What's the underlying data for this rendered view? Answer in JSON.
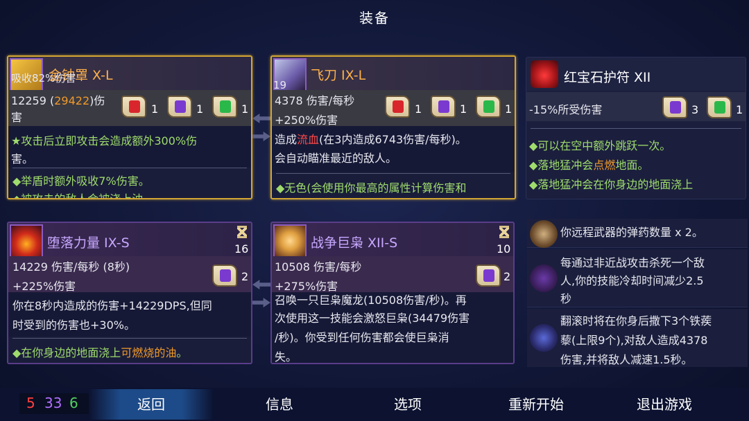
{
  "page": {
    "title": "装备"
  },
  "cards": {
    "weapon1": {
      "name": "金钟罩 X-L",
      "icon_count": "",
      "overlay": "吸收82%伤害",
      "stat1": "12259 (",
      "stat1_hi": "29422",
      "stat1_end": ")伤",
      "stat2": "害",
      "scrolls": [
        {
          "color": "red",
          "count": "1"
        },
        {
          "color": "purple",
          "count": "1"
        },
        {
          "color": "green",
          "count": "1"
        }
      ],
      "desc_line1_prefix": "★攻击后立即攻击会造成额外300%伤",
      "desc_line2": "害。",
      "mod1": "◆举盾时额外吸收7%伤害。",
      "mod2": "◆被攻击的敌人会被浇上油"
    },
    "weapon2": {
      "name": "飞刀 IX-L",
      "icon_count": "19",
      "stat1": "4378 伤害/每秒",
      "stat2": "+250%伤害",
      "scrolls": [
        {
          "color": "red",
          "count": "1"
        },
        {
          "color": "purple",
          "count": "1"
        },
        {
          "color": "green",
          "count": "1"
        }
      ],
      "desc_a": "造成",
      "desc_b": "流血",
      "desc_c": "(在3内造成6743伤害/每秒)。",
      "desc_line2": "会自动瞄准最近的敌人。",
      "mod1": "◆无色(会使用你最高的属性计算伤害和"
    },
    "amulet": {
      "name": "红宝石护符 XII",
      "stat1": "-15%所受伤害",
      "scrolls": [
        {
          "color": "purple",
          "count": "3"
        },
        {
          "color": "green",
          "count": "1"
        }
      ],
      "mod1": "◆可以在空中额外跳跃一次。",
      "mod2_a": "◆落地猛冲会",
      "mod2_b": "点燃",
      "mod2_c": "地面。",
      "mod3": "◆落地猛冲会在你身边的地面浇上"
    },
    "skill1": {
      "name": "堕落力量 IX-S",
      "cooldown": "16",
      "stat1": "14229 伤害/每秒 (8秒)",
      "stat2": "+225%伤害",
      "scrolls": [
        {
          "color": "purple",
          "count": "2"
        }
      ],
      "desc_line1": "你在8秒内造成的伤害+14229DPS,但同",
      "desc_line2": "时受到的伤害也+30%。",
      "mod1_a": "◆在你身边的地面浇上",
      "mod1_b": "可燃烧的油",
      "mod1_c": "。"
    },
    "skill2": {
      "name": "战争巨枭 XII-S",
      "cooldown": "10",
      "stat1": "10508 伤害/每秒",
      "stat2": "+275%伤害",
      "scrolls": [
        {
          "color": "purple",
          "count": "2"
        }
      ],
      "desc_line1": "召唤一只巨枭魔龙(10508伤害/秒)。再",
      "desc_line2": "次使用这一技能会激怒巨枭(34479伤害",
      "desc_line3": "/秒)。你受到任何伤害都会使巨枭消",
      "desc_line4": "失。"
    }
  },
  "mutations": [
    {
      "lines": [
        "你远程武器的弹药数量 x 2。"
      ]
    },
    {
      "lines": [
        "每通过非近战攻击杀死一个敌",
        "人,你的技能冷却时间减少2.5",
        "秒"
      ]
    },
    {
      "lines": [
        "翻滚时将在你身后撒下3个铁蒺",
        "藜(上限9个),对敌人造成4378",
        "伤害,并将敌人减速1.5秒。"
      ]
    }
  ],
  "stats": {
    "brutality": "5",
    "tactics": "33",
    "survival": "6"
  },
  "nav": {
    "back": "返回",
    "info": "信息",
    "options": "选项",
    "restart": "重新开始",
    "quit": "退出游戏"
  }
}
